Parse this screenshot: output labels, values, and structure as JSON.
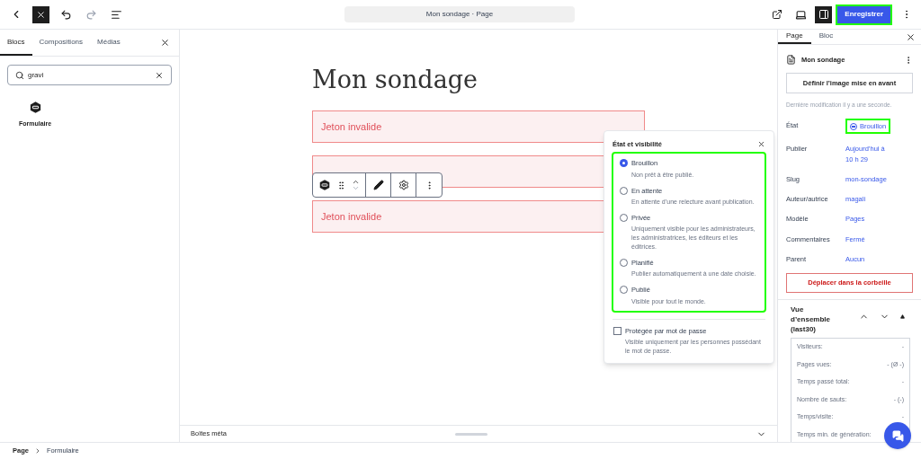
{
  "topbar": {
    "document_title": "Mon sondage · Page",
    "save_label": "Enregistrer"
  },
  "inserter": {
    "tabs": [
      {
        "label": "Blocs",
        "selected": true
      },
      {
        "label": "Compositions",
        "selected": false
      },
      {
        "label": "Médias",
        "selected": false
      }
    ],
    "search": {
      "value": "gravi"
    },
    "results": [
      {
        "label": "Formulaire"
      }
    ]
  },
  "editor": {
    "title": "Mon sondage",
    "notices": [
      {
        "kind": "message",
        "text": "Jeton invalide"
      },
      {
        "kind": "hidden"
      },
      {
        "kind": "message",
        "text": "Jeton invalide"
      }
    ],
    "meta_boxes": "Boîtes méta"
  },
  "status_popover": {
    "title": "État et visibilité",
    "options": [
      {
        "label": "Brouillon",
        "description": "Non prêt à être publié.",
        "selected": true
      },
      {
        "label": "En attente",
        "description": "En attente d’une relecture avant publication.",
        "selected": false
      },
      {
        "label": "Privée",
        "description": "Uniquement visible pour les administrateurs, les administratrices, les éditeurs et les éditrices.",
        "selected": false
      },
      {
        "label": "Planifié",
        "description": "Publier automatiquement à une date choisie.",
        "selected": false
      },
      {
        "label": "Publié",
        "description": "Visible pour tout le monde.",
        "selected": false
      }
    ],
    "password": {
      "label": "Protégée par mot de passe",
      "description": "Visible uniquement par les personnes possédant le mot de passe.",
      "checked": false
    }
  },
  "settings": {
    "tabs": [
      {
        "label": "Page",
        "selected": true
      },
      {
        "label": "Bloc",
        "selected": false
      }
    ],
    "doc_title": "Mon sondage",
    "featured_image": "Définir l’image mise en avant",
    "last_modified": "Dernière modification il y a une seconde.",
    "fields": [
      {
        "label": "État",
        "value": "Brouillon",
        "kind": "status"
      },
      {
        "label": "Publier",
        "value": "Aujourd’hui à 10 h 29",
        "kind": "link"
      },
      {
        "label": "Slug",
        "value": "mon-sondage",
        "kind": "link"
      },
      {
        "label": "Auteur/autrice",
        "value": "magali",
        "kind": "link"
      },
      {
        "label": "Modèle",
        "value": "Pages",
        "kind": "link"
      },
      {
        "label": "Commentaires",
        "value": "Fermé",
        "kind": "link"
      },
      {
        "label": "Parent",
        "value": "Aucun",
        "kind": "link"
      }
    ],
    "trash": "Déplacer dans la corbeille",
    "overview": {
      "title": "Vue d’ensemble (last30)",
      "rows": [
        {
          "label": "Visiteurs:",
          "value": "-"
        },
        {
          "label": "Pages vues:",
          "value": "- (Ø -)"
        },
        {
          "label": "Temps passé total:",
          "value": "-"
        },
        {
          "label": "Nombre de sauts:",
          "value": "- (-)"
        },
        {
          "label": "Temps/visite:",
          "value": "-"
        },
        {
          "label": "Temps min. de génération:",
          "value": ""
        }
      ]
    }
  },
  "breadcrumb": [
    {
      "label": "Page",
      "current": false
    },
    {
      "label": "Formulaire",
      "current": true
    }
  ]
}
